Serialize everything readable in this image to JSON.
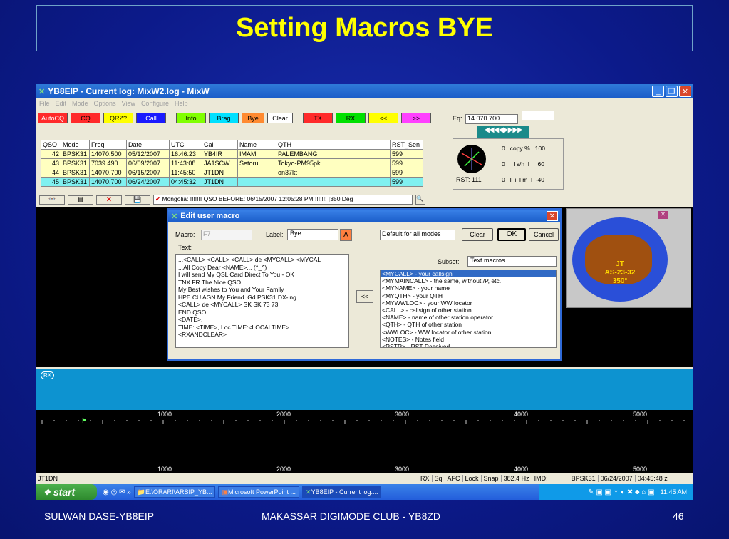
{
  "slide": {
    "title": "Setting Macros BYE",
    "footer_left": "SULWAN DASE-YB8EIP",
    "footer_center": "MAKASSAR DIGIMODE CLUB - YB8ZD",
    "footer_right": "46"
  },
  "window": {
    "title": "YB8EIP - Current log: MixW2.log - MixW",
    "menu": [
      "File",
      "Edit",
      "Mode",
      "Options",
      "View",
      "Configure",
      "Help"
    ]
  },
  "macro_buttons": [
    {
      "label": "AutoCQ",
      "bg": "#ff2a2a",
      "fg": "#ffffff"
    },
    {
      "label": "CQ",
      "bg": "#ff2a2a",
      "fg": "#000000"
    },
    {
      "label": "QRZ?",
      "bg": "#ffff00",
      "fg": "#000000"
    },
    {
      "label": "Call",
      "bg": "#1a1aff",
      "fg": "#ffffff"
    },
    {
      "label": "Info",
      "bg": "#80ff00",
      "fg": "#000000"
    },
    {
      "label": "Brag",
      "bg": "#00e0ff",
      "fg": "#000000"
    },
    {
      "label": "Bye",
      "bg": "#ff8a30",
      "fg": "#000000"
    },
    {
      "label": "Clear",
      "bg": "#ffffff",
      "fg": "#000000"
    },
    {
      "label": "TX",
      "bg": "#ff2a2a",
      "fg": "#000000"
    },
    {
      "label": "RX",
      "bg": "#00e000",
      "fg": "#000000"
    },
    {
      "label": "<<",
      "bg": "#ffff00",
      "fg": "#000000"
    },
    {
      "label": ">>",
      "bg": "#ff40ff",
      "fg": "#000000"
    }
  ],
  "eq": {
    "label": "Eq:",
    "value": "14.070.700",
    "nav": "◀◀◀◀▶▶▶▶"
  },
  "meter": {
    "row1": "0   copy %   100",
    "row2": "0     l s/n  l     60",
    "row3": "0   l  i  l m  l  -40",
    "rst": "RST: 111"
  },
  "qso_table": {
    "headers": [
      "QSO",
      "Mode",
      "Freq",
      "Date",
      "UTC",
      "Call",
      "Name",
      "QTH",
      "RST_Sen"
    ],
    "rows": [
      [
        "42",
        "BPSK31",
        "14070.500",
        "05/12/2007",
        "16:46:23",
        "YB4IR",
        "IMAM",
        "PALEMBANG",
        "599"
      ],
      [
        "43",
        "BPSK31",
        "7039.490",
        "06/09/2007",
        "11:43:08",
        "JA1SCW",
        "Setoru",
        "Tokyo-PM95pk",
        "599"
      ],
      [
        "44",
        "BPSK31",
        "14070.700",
        "06/15/2007",
        "11:45:50",
        "JT1DN",
        "",
        "on37kt",
        "599"
      ],
      [
        "45",
        "BPSK31",
        "14070.700",
        "06/24/2007",
        "04:45:32",
        "JT1DN",
        "",
        "",
        "599"
      ]
    ]
  },
  "info_line": "Mongolia:  !!!!!!! QSO BEFORE: 06/15/2007 12:05:28 PM !!!!!!! [350 Deg",
  "dialog": {
    "title": "Edit user macro",
    "macro_label": "Macro:",
    "macro_value": "F7",
    "label_label": "Label:",
    "label_value": "Bye",
    "mode_select": "Default for all modes",
    "clear_btn": "Clear",
    "ok_btn": "OK",
    "cancel_btn": "Cancel",
    "text_label": "Text:",
    "subset_label": "Subset:",
    "subset_value": "Text macros",
    "insert_btn": "<<",
    "text_lines": [
      "...<CALL>  <CALL> <CALL> de  <MYCALL>   <MYCAL",
      "...All Copy Dear  <NAME>... (^_^)",
      "I will send My QSL Card Direct To You - OK",
      "TNX FR The Nice QSO",
      "My Best wishes to You and Your Family",
      "HPE CU AGN My Friend..Gd PSK31 DX-ing ,",
      "<CALL> de <MYCALL> SK SK 73 73",
      "END QSO:",
      "<DATE>,",
      "TIME: <TIME>,  Loc TIME:<LOCALTIME>",
      "<RXANDCLEAR>"
    ],
    "macros": [
      "<MYCALL> - your callsign",
      "<MYMAINCALL> - the same, without /P, etc.",
      "<MYNAME> - your name",
      "<MYQTH> - your QTH",
      "<MYWWLOC> - your WW locator",
      "<CALL> - callsign of other station",
      "<NAME> - name of other station operator",
      "<QTH> - QTH of other station",
      "<WWLOC> - WW locator of other station",
      "<NOTES> - Notes field",
      "<RSTR> - RST Received"
    ]
  },
  "globe": {
    "line1": "JT",
    "line2": "AS-23-32",
    "line3": "350°"
  },
  "rx_tag": "RX",
  "ruler_labels": [
    "1000",
    "2000",
    "3000",
    "4000",
    "5000"
  ],
  "status": {
    "left": "JT1DN",
    "rx": "RX",
    "sq": "Sq",
    "afc": "AFC",
    "lock": "Lock",
    "snap": "Snap",
    "freq": "382.4 Hz",
    "imd": "IMD:",
    "mode": "BPSK31",
    "date": "06/24/2007",
    "time": "04:45:48 z"
  },
  "taskbar": {
    "start": "start",
    "tasks": [
      "E:\\ORARI\\ARSIP_YB...",
      "Microsoft PowerPoint ...",
      "YB8EIP - Current log:..."
    ],
    "clock": "11:45 AM"
  }
}
